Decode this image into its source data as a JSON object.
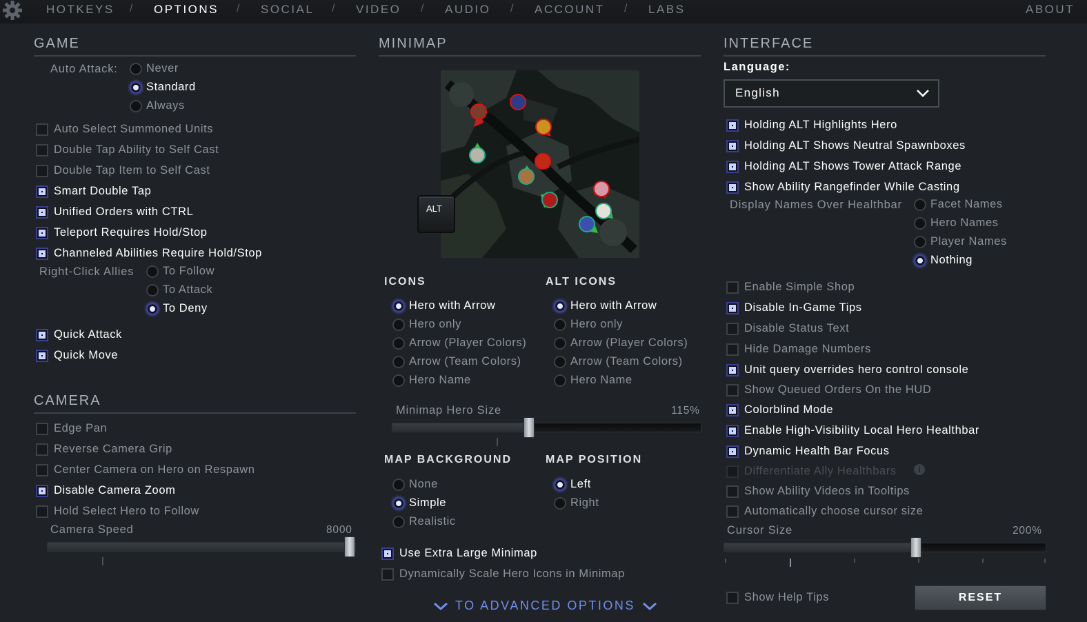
{
  "nav": {
    "tabs": [
      "HOTKEYS",
      "OPTIONS",
      "SOCIAL",
      "VIDEO",
      "AUDIO",
      "ACCOUNT",
      "LABS"
    ],
    "separator": "/",
    "about": "ABOUT"
  },
  "game": {
    "title": "GAME",
    "auto_attack_label": "Auto Attack:",
    "auto_attack_options": [
      "Never",
      "Standard",
      "Always"
    ],
    "checkboxes": [
      "Auto Select Summoned Units",
      "Double Tap Ability to Self Cast",
      "Double Tap Item to Self Cast",
      "Smart Double Tap",
      "Unified Orders with CTRL",
      "Teleport Requires Hold/Stop",
      "Channeled Abilities Require Hold/Stop"
    ],
    "right_click_label": "Right-Click Allies",
    "right_click_options": [
      "To Follow",
      "To Attack",
      "To Deny"
    ],
    "quick_attack": "Quick Attack",
    "quick_move": "Quick Move"
  },
  "camera": {
    "title": "CAMERA",
    "checkboxes": [
      "Edge Pan",
      "Reverse Camera Grip",
      "Center Camera on Hero on Respawn",
      "Disable Camera Zoom",
      "Hold Select Hero to Follow"
    ],
    "speed_label": "Camera Speed",
    "speed_value": "8000",
    "speed_fraction": 1.0
  },
  "minimap": {
    "title": "MINIMAP",
    "alt_key": "ALT",
    "icons_title": "ICONS",
    "alt_icons_title": "ALT ICONS",
    "icon_options": [
      "Hero with Arrow",
      "Hero only",
      "Arrow (Player Colors)",
      "Arrow (Team Colors)",
      "Hero Name"
    ],
    "hero_size_label": "Minimap Hero Size",
    "hero_size_value": "115%",
    "hero_size_fraction": 0.44,
    "background_title": "MAP BACKGROUND",
    "background_options": [
      "None",
      "Simple",
      "Realistic"
    ],
    "position_title": "MAP POSITION",
    "position_options": [
      "Left",
      "Right"
    ],
    "extra_large": "Use Extra Large Minimap",
    "dynamic_scale": "Dynamically Scale Hero Icons in Minimap",
    "advanced_link": "TO ADVANCED OPTIONS"
  },
  "interface": {
    "title": "INTERFACE",
    "language_label": "Language:",
    "language_value": "English",
    "alt_checkboxes": [
      "Holding ALT Highlights Hero",
      "Holding ALT Shows Neutral Spawnboxes",
      "Holding ALT Shows Tower Attack Range",
      "Show Ability Rangefinder While Casting"
    ],
    "display_names_label": "Display Names Over Healthbar",
    "display_names_options": [
      "Facet Names",
      "Hero Names",
      "Player Names",
      "Nothing"
    ],
    "checkboxes": [
      "Enable Simple Shop",
      "Disable In-Game Tips",
      "Disable Status Text",
      "Hide Damage Numbers",
      "Unit query overrides hero control console",
      "Show Queued Orders On the HUD",
      "Colorblind Mode",
      "Enable High-Visibility Local Hero Healthbar",
      "Dynamic Health Bar Focus",
      "Differentiate Ally Healthbars",
      "Show Ability Videos in Tooltips",
      "Automatically choose cursor size"
    ],
    "cursor_size_label": "Cursor Size",
    "cursor_size_value": "200%",
    "cursor_size_fraction": 0.6,
    "help_tips": "Show Help Tips",
    "reset": "RESET"
  }
}
